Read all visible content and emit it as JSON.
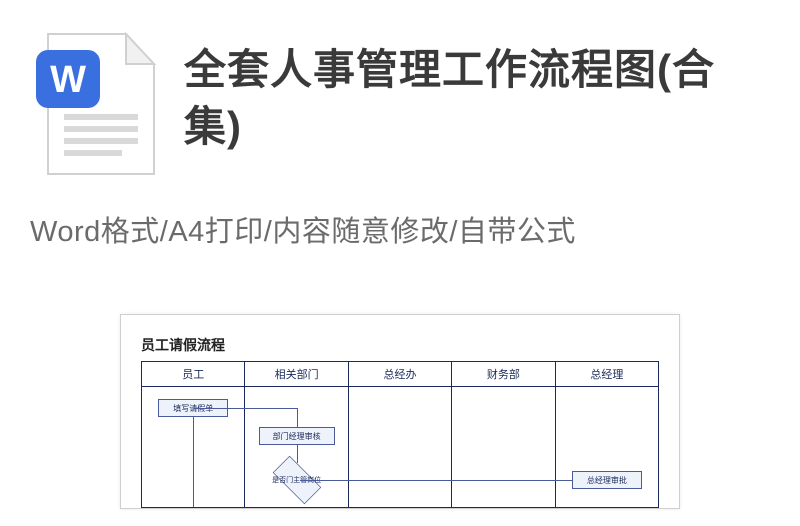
{
  "header": {
    "title": "全套人事管理工作流程图(合集)"
  },
  "subtitle": "Word格式/A4打印/内容随意修改/自带公式",
  "icon": {
    "letter": "W"
  },
  "preview": {
    "flow_title": "员工请假流程",
    "columns": [
      "员工",
      "相关部门",
      "总经办",
      "财务部",
      "总经理"
    ],
    "nodes": {
      "start": "填写请假单",
      "dept_review": "部门经理审核",
      "dept_head": "是否门主管岗位",
      "gm_review": "总经理审批"
    }
  }
}
